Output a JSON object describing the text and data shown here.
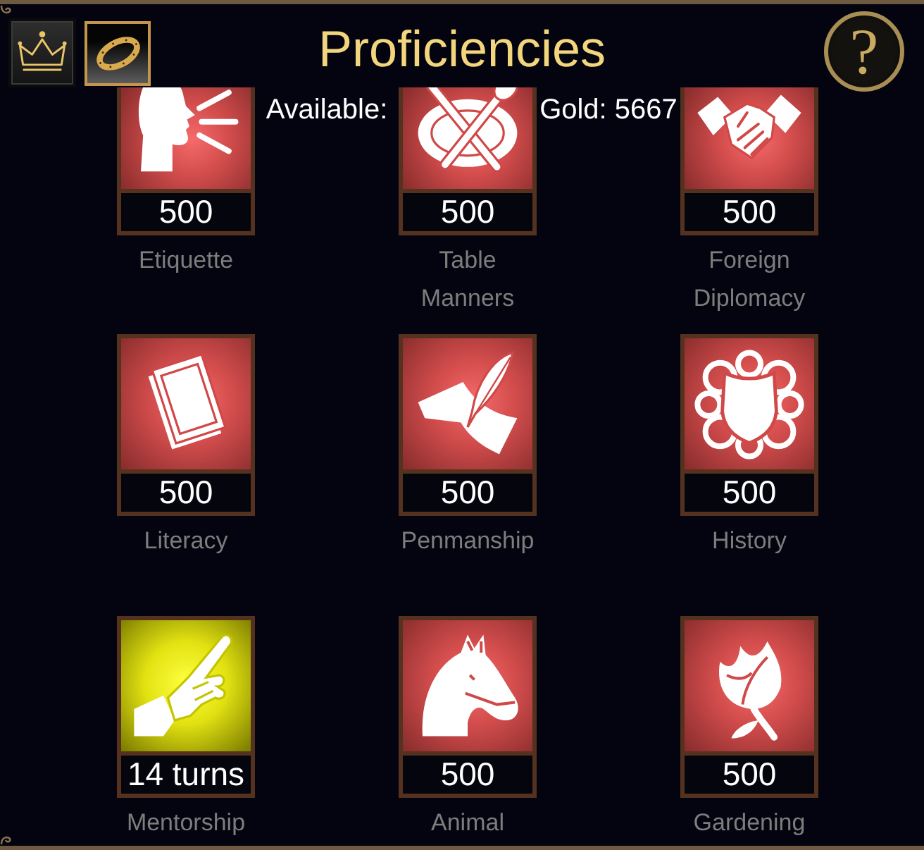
{
  "header": {
    "tabs": [
      {
        "selected": false
      },
      {
        "selected": true
      }
    ],
    "title": "Proficiencies",
    "help_button": {
      "label": "?"
    }
  },
  "status": {
    "available": "Available:",
    "gold": "Gold: 5667"
  },
  "proficiencies": [
    {
      "name": "Etiquette",
      "value": "500",
      "in_progress": false
    },
    {
      "name": "Table Manners",
      "value": "500",
      "in_progress": false
    },
    {
      "name": "Foreign Diplomacy",
      "value": "500",
      "in_progress": false
    },
    {
      "name": "Literacy",
      "value": "500",
      "in_progress": false
    },
    {
      "name": "Penmanship",
      "value": "500",
      "in_progress": false
    },
    {
      "name": "History",
      "value": "500",
      "in_progress": false
    },
    {
      "name": "Mentorship",
      "value": "14 turns",
      "in_progress": true
    },
    {
      "name": "Animal",
      "value": "500",
      "in_progress": false
    },
    {
      "name": "Gardening",
      "value": "500",
      "in_progress": false
    }
  ]
}
